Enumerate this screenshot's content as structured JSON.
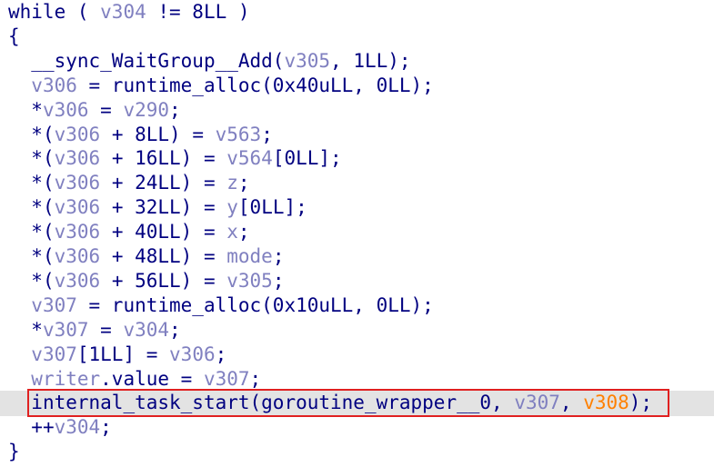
{
  "colors": {
    "code": "#000080",
    "variable": "#8080c0",
    "highlighted_variable": "#ff8000",
    "highlight_row": "#e3e3e3",
    "highlight_box": "#e02020"
  },
  "lines": [
    {
      "indent": "",
      "tokens": [
        {
          "t": "while ( ",
          "c": "code"
        },
        {
          "t": "v304",
          "c": "var"
        },
        {
          "t": " != 8LL )",
          "c": "code"
        }
      ]
    },
    {
      "indent": "",
      "tokens": [
        {
          "t": "{",
          "c": "code"
        }
      ]
    },
    {
      "indent": "  ",
      "tokens": [
        {
          "t": "__sync_WaitGroup__Add(",
          "c": "code"
        },
        {
          "t": "v305",
          "c": "var"
        },
        {
          "t": ", 1LL);",
          "c": "code"
        }
      ]
    },
    {
      "indent": "  ",
      "tokens": [
        {
          "t": "v306",
          "c": "var"
        },
        {
          "t": " = runtime_alloc(0x40uLL, 0LL);",
          "c": "code"
        }
      ]
    },
    {
      "indent": "  ",
      "tokens": [
        {
          "t": "*",
          "c": "code"
        },
        {
          "t": "v306",
          "c": "var"
        },
        {
          "t": " = ",
          "c": "code"
        },
        {
          "t": "v290",
          "c": "var"
        },
        {
          "t": ";",
          "c": "code"
        }
      ]
    },
    {
      "indent": "  ",
      "tokens": [
        {
          "t": "*(",
          "c": "code"
        },
        {
          "t": "v306",
          "c": "var"
        },
        {
          "t": " + 8LL) = ",
          "c": "code"
        },
        {
          "t": "v563",
          "c": "var"
        },
        {
          "t": ";",
          "c": "code"
        }
      ]
    },
    {
      "indent": "  ",
      "tokens": [
        {
          "t": "*(",
          "c": "code"
        },
        {
          "t": "v306",
          "c": "var"
        },
        {
          "t": " + 16LL) = ",
          "c": "code"
        },
        {
          "t": "v564",
          "c": "var"
        },
        {
          "t": "[0LL];",
          "c": "code"
        }
      ]
    },
    {
      "indent": "  ",
      "tokens": [
        {
          "t": "*(",
          "c": "code"
        },
        {
          "t": "v306",
          "c": "var"
        },
        {
          "t": " + 24LL) = ",
          "c": "code"
        },
        {
          "t": "z",
          "c": "var"
        },
        {
          "t": ";",
          "c": "code"
        }
      ]
    },
    {
      "indent": "  ",
      "tokens": [
        {
          "t": "*(",
          "c": "code"
        },
        {
          "t": "v306",
          "c": "var"
        },
        {
          "t": " + 32LL) = ",
          "c": "code"
        },
        {
          "t": "y",
          "c": "var"
        },
        {
          "t": "[0LL];",
          "c": "code"
        }
      ]
    },
    {
      "indent": "  ",
      "tokens": [
        {
          "t": "*(",
          "c": "code"
        },
        {
          "t": "v306",
          "c": "var"
        },
        {
          "t": " + 40LL) = ",
          "c": "code"
        },
        {
          "t": "x",
          "c": "var"
        },
        {
          "t": ";",
          "c": "code"
        }
      ]
    },
    {
      "indent": "  ",
      "tokens": [
        {
          "t": "*(",
          "c": "code"
        },
        {
          "t": "v306",
          "c": "var"
        },
        {
          "t": " + 48LL) = ",
          "c": "code"
        },
        {
          "t": "mode",
          "c": "var"
        },
        {
          "t": ";",
          "c": "code"
        }
      ]
    },
    {
      "indent": "  ",
      "tokens": [
        {
          "t": "*(",
          "c": "code"
        },
        {
          "t": "v306",
          "c": "var"
        },
        {
          "t": " + 56LL) = ",
          "c": "code"
        },
        {
          "t": "v305",
          "c": "var"
        },
        {
          "t": ";",
          "c": "code"
        }
      ]
    },
    {
      "indent": "  ",
      "tokens": [
        {
          "t": "v307",
          "c": "var"
        },
        {
          "t": " = runtime_alloc(0x10uLL, 0LL);",
          "c": "code"
        }
      ]
    },
    {
      "indent": "  ",
      "tokens": [
        {
          "t": "*",
          "c": "code"
        },
        {
          "t": "v307",
          "c": "var"
        },
        {
          "t": " = ",
          "c": "code"
        },
        {
          "t": "v304",
          "c": "var"
        },
        {
          "t": ";",
          "c": "code"
        }
      ]
    },
    {
      "indent": "  ",
      "tokens": [
        {
          "t": "v307",
          "c": "var"
        },
        {
          "t": "[1LL] = ",
          "c": "code"
        },
        {
          "t": "v306",
          "c": "var"
        },
        {
          "t": ";",
          "c": "code"
        }
      ]
    },
    {
      "indent": "  ",
      "tokens": [
        {
          "t": "writer",
          "c": "var"
        },
        {
          "t": ".value = ",
          "c": "code"
        },
        {
          "t": "v307",
          "c": "var"
        },
        {
          "t": ";",
          "c": "code"
        }
      ]
    },
    {
      "indent": "  ",
      "highlighted": true,
      "tokens": [
        {
          "t": "internal_task_start(goroutine_wrapper__0, ",
          "c": "code"
        },
        {
          "t": "v307",
          "c": "var"
        },
        {
          "t": ", ",
          "c": "code"
        },
        {
          "t": "v308",
          "c": "hot"
        },
        {
          "t": ");",
          "c": "code"
        }
      ]
    },
    {
      "indent": "  ",
      "tokens": [
        {
          "t": "++",
          "c": "code"
        },
        {
          "t": "v304",
          "c": "var"
        },
        {
          "t": ";",
          "c": "code"
        }
      ]
    },
    {
      "indent": "",
      "tokens": [
        {
          "t": "}",
          "c": "code"
        }
      ]
    }
  ]
}
